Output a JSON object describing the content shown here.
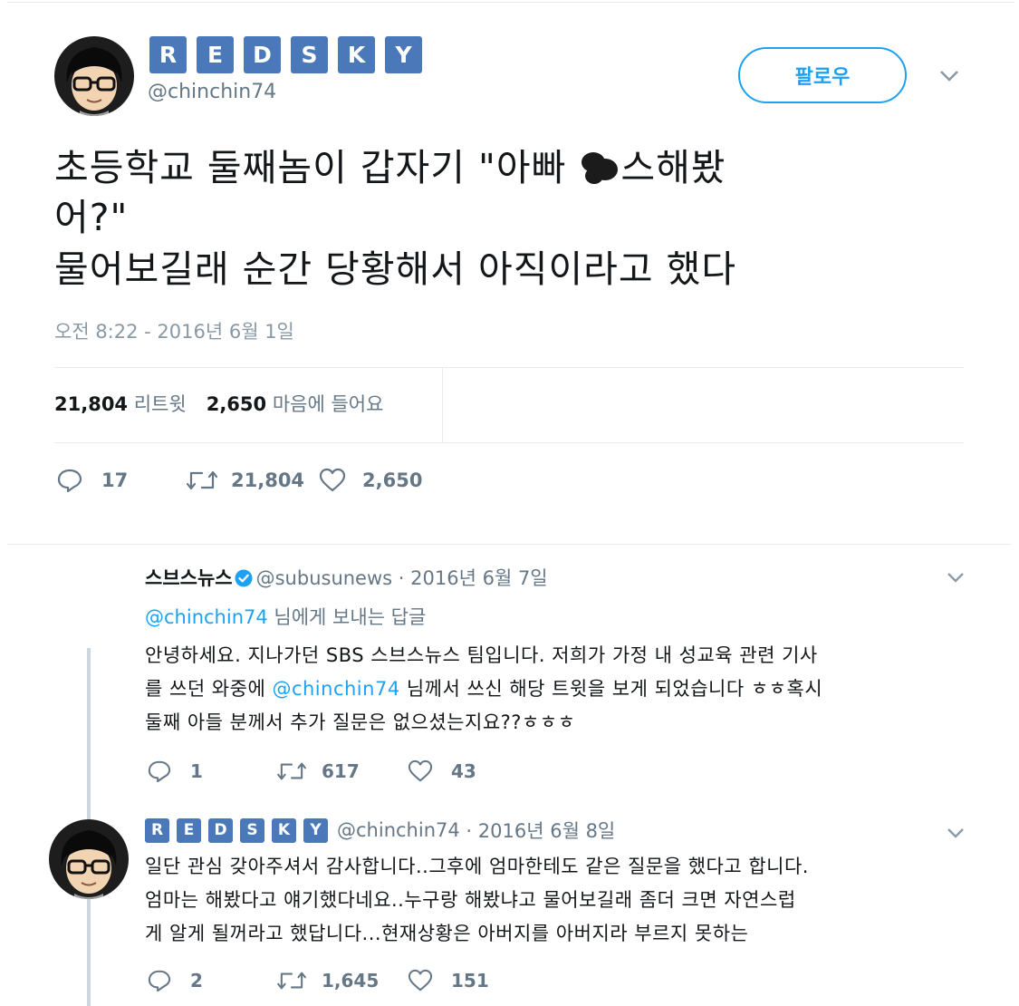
{
  "tweet": {
    "badges": [
      "R",
      "E",
      "D",
      "S",
      "K",
      "Y"
    ],
    "handle": "@chinchin74",
    "follow_label": "팔로우",
    "text": {
      "line1_a": "초등학교 둘째놈이 갑자기 \"아빠 ",
      "line1_b": "스해봤",
      "line2": "어?\"",
      "line3": "물어보길래 순간 당황해서  아직이라고 했다"
    },
    "timestamp": "오전 8:22 - 2016년 6월 1일",
    "stats": {
      "retweets_count": "21,804",
      "retweets_label": "리트윗",
      "likes_count": "2,650",
      "likes_label": "마음에 들어요"
    },
    "actions": {
      "replies": "17",
      "retweets": "21,804",
      "likes": "2,650"
    }
  },
  "replies": [
    {
      "name": "스브스뉴스",
      "handle": "@subusunews",
      "date": "· 2016년 6월 7일",
      "reply_to_mention": "@chinchin74",
      "reply_to_suffix": " 님에게 보내는 답글",
      "body_line1": "안녕하세요. 지나가던 SBS 스브스뉴스 팀입니다. 저희가 가정 내 성교육 관련 기사",
      "body_line2_a": "를 쓰던 와중에 ",
      "body_line2_mention": "@chinchin74",
      "body_line2_b": " 님께서 쓰신 해당 트윗을 보게 되었습니다 ㅎㅎ혹시",
      "body_line3": "둘째 아들 분께서 추가 질문은 없으셨는지요??ㅎㅎㅎ",
      "actions": {
        "replies": "1",
        "retweets": "617",
        "likes": "43"
      }
    },
    {
      "badges": [
        "R",
        "E",
        "D",
        "S",
        "K",
        "Y"
      ],
      "handle": "@chinchin74",
      "date": "· 2016년 6월 8일",
      "body_line1": "일단 관심 갖아주셔서 감사합니다..그후에 엄마한테도 같은 질문을 했다고 합니다.",
      "body_line2": "엄마는 해봤다고 얘기했다네요..누구랑 해봤냐고 물어보길래 좀더 크면 자연스럽",
      "body_line3": "게 알게 될꺼라고 했답니다...현재상황은 아버지를 아버지라 부르지 못하는",
      "actions": {
        "replies": "2",
        "retweets": "1,645",
        "likes": "151"
      }
    }
  ],
  "colors": {
    "accent": "#1da1f2",
    "badge": "#4a78b8",
    "muted": "#657786",
    "text": "#14171a"
  }
}
